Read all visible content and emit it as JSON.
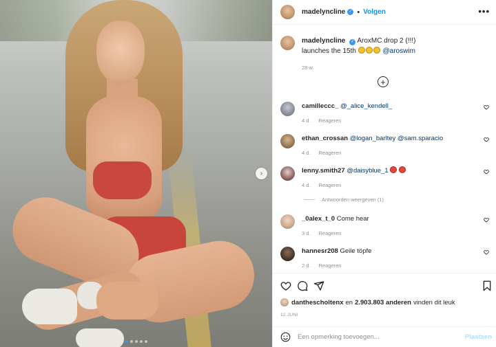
{
  "post": {
    "username": "madelyncline",
    "follow_label": "Volgen",
    "separator": "•",
    "more_label": "•••"
  },
  "caption": {
    "username": "madelyncline",
    "text_line1": "AroxMC drop 2 (!!!)",
    "text_line2": "launches the 15th",
    "mention": "@aroswim",
    "time": "28 w."
  },
  "comments": [
    {
      "username": "camilleccc_",
      "text": "",
      "mention": "@_alice_kendell_",
      "time": "4 d.",
      "reply_label": "Reageren",
      "emoji": []
    },
    {
      "username": "ethan_crossan",
      "text": "",
      "mention": "@logan_barltey @sam.sparacio",
      "time": "4 d.",
      "reply_label": "Reageren",
      "emoji": []
    },
    {
      "username": "lenny.smith27",
      "text": "",
      "mention": "@daisyblue_1",
      "time": "4 d.",
      "reply_label": "Reageren",
      "emoji": [
        "heart-eyes",
        "heart-eyes"
      ]
    },
    {
      "username": "_0alex_t_0",
      "text": "Come hear",
      "mention": "",
      "time": "3 d.",
      "reply_label": "Reageren",
      "emoji": []
    },
    {
      "username": "hannesr208",
      "text": "Geile töpfe",
      "mention": "",
      "time": "2 d.",
      "reply_label": "Reageren",
      "emoji": []
    }
  ],
  "view_replies_label": "Antwoorden weergeven (1)",
  "likes": {
    "user": "danthescholtenx",
    "and_text": "en",
    "count": "2.903.803 anderen",
    "suffix": "vinden dit leuk"
  },
  "date": "12 JUNI",
  "compose": {
    "placeholder": "Een opmerking toevoegen...",
    "post_label": "Plaatsen"
  },
  "carousel": {
    "total_slides": 5,
    "active_slide": 1
  },
  "colors": {
    "accent": "#0095f6",
    "verified": "#3897f0",
    "link": "#00376b",
    "muted": "#8e8e8e"
  },
  "icons": [
    "verified-icon",
    "more-icon",
    "next-icon",
    "add-comment-icon",
    "heart-icon",
    "comment-icon",
    "share-icon",
    "bookmark-icon",
    "smiley-icon"
  ]
}
